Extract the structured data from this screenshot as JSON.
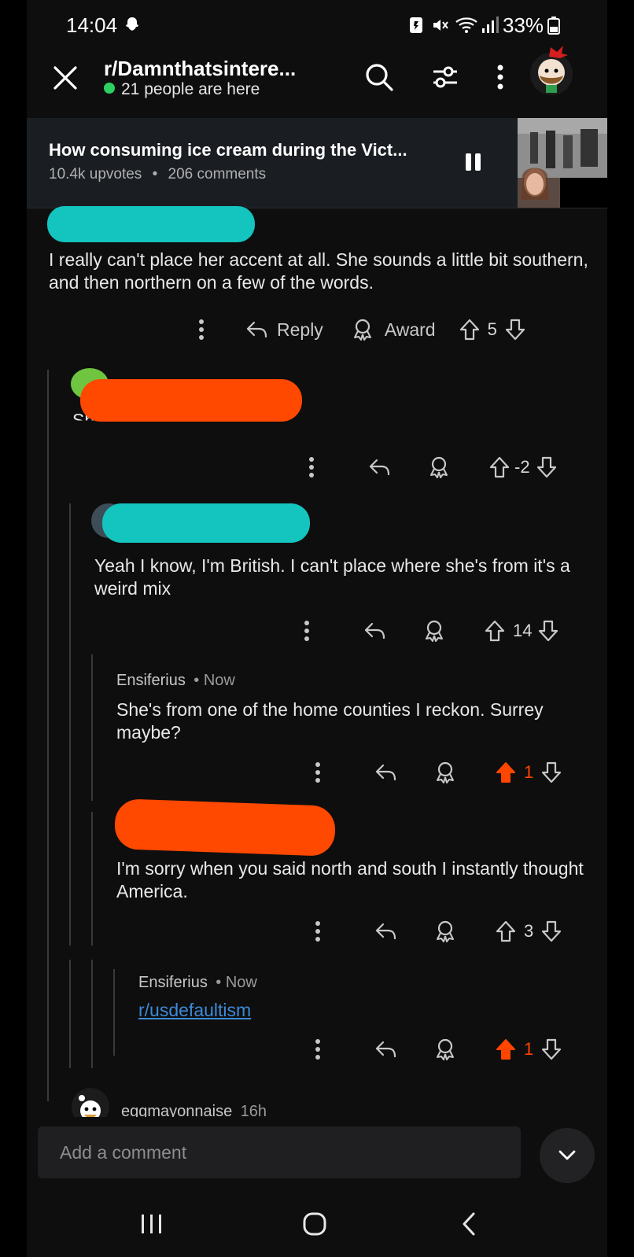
{
  "status_bar": {
    "time": "14:04",
    "battery": "33%"
  },
  "header": {
    "subreddit": "r/Damnthatsintere...",
    "online": "21 people are here"
  },
  "post": {
    "title": "How consuming ice cream during the Vict...",
    "upvotes": "10.4k upvotes",
    "separator": "•",
    "comments": "206 comments"
  },
  "comments": [
    {
      "text": "I really can't place her accent at all. She sounds a little bit southern, and then northern on a few of the words.",
      "reply_label": "Reply",
      "award_label": "Award",
      "votes": "5"
    },
    {
      "text": "She's British",
      "votes": "-2"
    },
    {
      "text": "Yeah I know, I'm British. I can't place where she's from it's a weird mix",
      "votes": "14"
    },
    {
      "username": "Ensiferius",
      "time": "• Now",
      "text": "She's from one of the home counties I reckon. Surrey maybe?",
      "votes": "1"
    },
    {
      "text": "I'm sorry when you said north and south I instantly thought America.",
      "votes": "3"
    },
    {
      "username": "Ensiferius",
      "time": "• Now",
      "link": "r/usdefaultism",
      "votes": "1"
    },
    {
      "username": "eggmayonnaise",
      "time": "16h"
    }
  ],
  "add_comment": {
    "placeholder": "Add a comment"
  },
  "colors": {
    "upvote_active": "#ff4500",
    "online": "#2dd162",
    "link": "#3c8ad8"
  }
}
